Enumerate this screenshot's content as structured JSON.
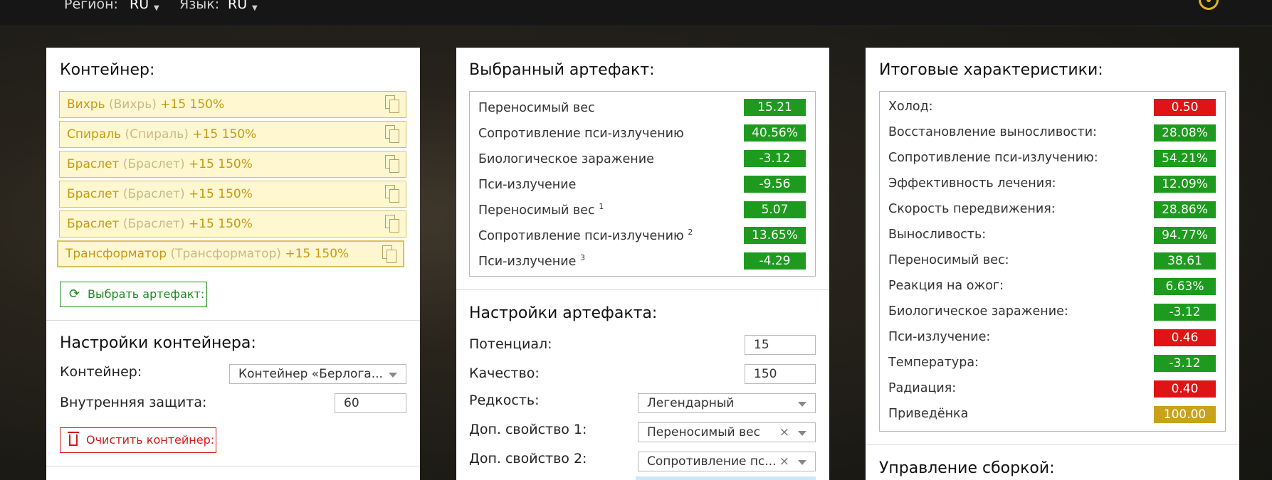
{
  "topbar": {
    "region_label": "Регион:",
    "region_value": "RU",
    "lang_label": "Язык:",
    "lang_value": "RU",
    "theme_icon": "sun-icon"
  },
  "container_panel": {
    "title": "Контейнер:",
    "items": [
      {
        "name": "Вихрь",
        "alt": "(Вихрь)",
        "stats": "+15 150%"
      },
      {
        "name": "Спираль",
        "alt": "(Спираль)",
        "stats": "+15 150%"
      },
      {
        "name": "Браслет",
        "alt": "(Браслет)",
        "stats": "+15 150%"
      },
      {
        "name": "Браслет",
        "alt": "(Браслет)",
        "stats": "+15 150%"
      },
      {
        "name": "Браслет",
        "alt": "(Браслет)",
        "stats": "+15 150%"
      },
      {
        "name": "Трансформатор",
        "alt": "(Трансформатор)",
        "stats": "+15 150%"
      }
    ],
    "choose_button": "Выбрать артефакт:",
    "settings_title": "Настройки контейнера:",
    "container_label": "Контейнер:",
    "container_value": "Контейнер «Берлога...",
    "protection_label": "Внутренняя защита:",
    "protection_value": "60",
    "clear_button": "Очистить контейнер:"
  },
  "artifact_panel": {
    "title": "Выбранный артефакт:",
    "stats": [
      {
        "label": "Переносимый вес",
        "sup": "",
        "value": "15.21",
        "color": "#1e9b1e"
      },
      {
        "label": "Сопротивление пси-излучению",
        "sup": "",
        "value": "40.56%",
        "color": "#1e9b1e"
      },
      {
        "label": "Биологическое заражение",
        "sup": "",
        "value": "-3.12",
        "color": "#1e9b1e"
      },
      {
        "label": "Пси-излучение",
        "sup": "",
        "value": "-9.56",
        "color": "#1e9b1e"
      },
      {
        "label": "Переносимый вес",
        "sup": "1",
        "value": "5.07",
        "color": "#1e9b1e"
      },
      {
        "label": "Сопротивление пси-излучению",
        "sup": "2",
        "value": "13.65%",
        "color": "#1e9b1e"
      },
      {
        "label": "Пси-излучение",
        "sup": "3",
        "value": "-4.29",
        "color": "#1e9b1e"
      }
    ],
    "settings_title": "Настройки артефакта:",
    "potential_label": "Потенциал:",
    "potential_value": "15",
    "quality_label": "Качество:",
    "quality_value": "150",
    "rarity_label": "Редкость:",
    "rarity_value": "Легендарный",
    "extra1_label": "Доп. свойство 1:",
    "extra1_value": "Переносимый вес",
    "extra2_label": "Доп. свойство 2:",
    "extra2_value": "Сопротивление пс...",
    "clear_symbol": "×"
  },
  "totals_panel": {
    "title": "Итоговые характеристики:",
    "stats": [
      {
        "label": "Холод:",
        "value": "0.50",
        "color": "#e01414"
      },
      {
        "label": "Восстановление выносливости:",
        "value": "28.08%",
        "color": "#1e9b1e"
      },
      {
        "label": "Сопротивление пси-излучению:",
        "value": "54.21%",
        "color": "#1e9b1e"
      },
      {
        "label": "Эффективность лечения:",
        "value": "12.09%",
        "color": "#1e9b1e"
      },
      {
        "label": "Скорость передвижения:",
        "value": "28.86%",
        "color": "#1e9b1e"
      },
      {
        "label": "Выносливость:",
        "value": "94.77%",
        "color": "#1e9b1e"
      },
      {
        "label": "Переносимый вес:",
        "value": "38.61",
        "color": "#1e9b1e"
      },
      {
        "label": "Реакция на ожог:",
        "value": "6.63%",
        "color": "#1e9b1e"
      },
      {
        "label": "Биологическое заражение:",
        "value": "-3.12",
        "color": "#1e9b1e"
      },
      {
        "label": "Пси-излучение:",
        "value": "0.46",
        "color": "#e01414"
      },
      {
        "label": "Температура:",
        "value": "-3.12",
        "color": "#1e9b1e"
      },
      {
        "label": "Радиация:",
        "value": "0.40",
        "color": "#e01414"
      },
      {
        "label": "Приведёнка",
        "value": "100.00",
        "color": "#c9a21c"
      }
    ],
    "build_title": "Управление сборкой:"
  }
}
